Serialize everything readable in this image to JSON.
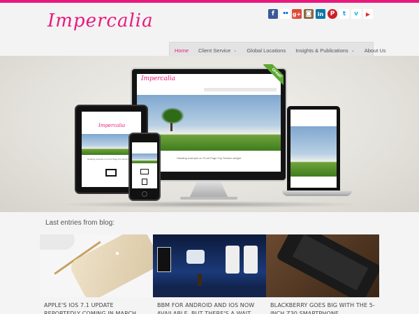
{
  "header": {
    "logo_text": "Impercalia",
    "social_icons": [
      {
        "name": "facebook-icon",
        "glyph": "f",
        "color": "#3b5998"
      },
      {
        "name": "flickr-icon",
        "glyph": "••",
        "color": "#f7f7f7"
      },
      {
        "name": "google-plus-icon",
        "glyph": "g+",
        "color": "#dd4b39"
      },
      {
        "name": "instagram-icon",
        "glyph": "◙",
        "color": "#8a6a4a"
      },
      {
        "name": "linkedin-icon",
        "glyph": "in",
        "color": "#0e76a8"
      },
      {
        "name": "pinterest-icon",
        "glyph": "P",
        "color": "#cb2027"
      },
      {
        "name": "twitter-icon",
        "glyph": "t",
        "color": "#1da1f2"
      },
      {
        "name": "vimeo-icon",
        "glyph": "v",
        "color": "#1ab7ea"
      },
      {
        "name": "youtube-icon",
        "glyph": "▶",
        "color": "#e52d27"
      }
    ]
  },
  "nav": {
    "items": [
      {
        "label": "Home",
        "active": true,
        "dropdown": false
      },
      {
        "label": "Client Service",
        "active": false,
        "dropdown": true
      },
      {
        "label": "Global Locations",
        "active": false,
        "dropdown": false
      },
      {
        "label": "Insights & Publications",
        "active": false,
        "dropdown": true
      },
      {
        "label": "About Us",
        "active": false,
        "dropdown": false
      }
    ]
  },
  "hero": {
    "ribbon_label": "Great!",
    "monitor_caption": "Heading example on Front Page Top Section widget",
    "tablet_caption": "Heading example on Front Page Top Section widget"
  },
  "blog": {
    "heading": "Last entries from blog:",
    "entries": [
      {
        "title": "APPLE'S IOS 7.1 UPDATE REPORTEDLY COMING IN MARCH"
      },
      {
        "title": "BBM FOR ANDROID AND IOS NOW AVAILABLE, BUT THERE'S A WAIT LIST"
      },
      {
        "title": "BLACKBERRY GOES BIG WITH THE 5-INCH Z30 SMARTPHONE"
      }
    ]
  },
  "colors": {
    "accent": "#e8197d",
    "nav_bg": "#e3e3e3",
    "page_bg": "#f4f4f4"
  }
}
